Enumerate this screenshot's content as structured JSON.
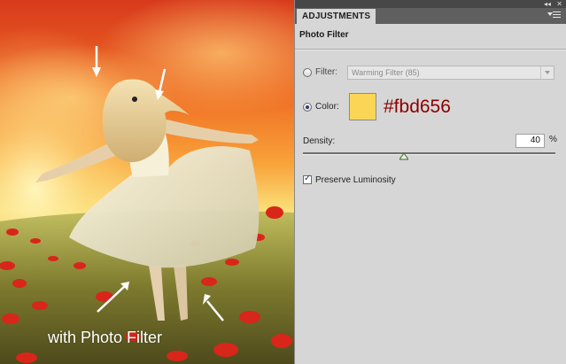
{
  "photo": {
    "caption": "with Photo Filter"
  },
  "panel": {
    "tab_label": "ADJUSTMENTS",
    "title": "Photo Filter",
    "filter": {
      "label": "Filter:",
      "selected": "Warming Filter (85)",
      "checked": false
    },
    "color": {
      "label": "Color:",
      "checked": true,
      "swatch_hex": "#fbd656",
      "hex_text": "#fbd656"
    },
    "density": {
      "label": "Density:",
      "value": "40",
      "unit": "%",
      "level_percent": 40
    },
    "preserve_luminosity": {
      "label": "Preserve Luminosity",
      "checked": true
    }
  },
  "colors": {
    "hex_text": "#8b0000",
    "panel_bg": "#d6d6d6",
    "tab_bar": "#5f5f5f",
    "top_bar": "#474747"
  },
  "icons": [
    "collapse-icon",
    "close-icon",
    "panel-menu-icon",
    "dropdown-arrow-icon",
    "slider-thumb-icon",
    "checkmark-icon",
    "arrow-pointer-icon"
  ]
}
